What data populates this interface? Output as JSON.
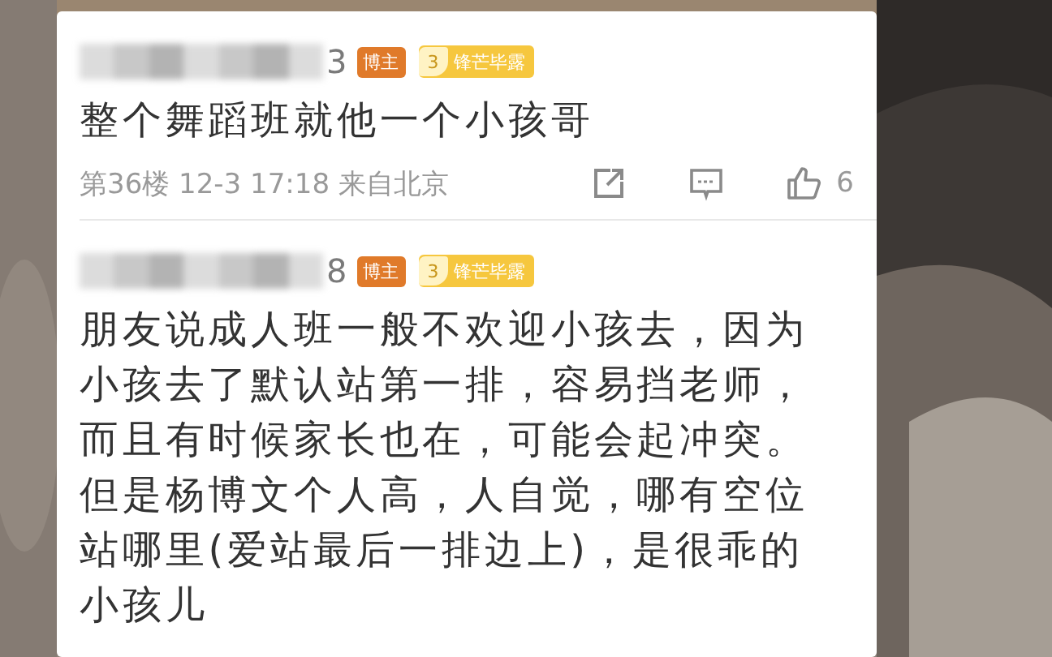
{
  "comments": [
    {
      "name_end": "3",
      "badges": [
        {
          "kind": "role",
          "label": "博主"
        },
        {
          "kind": "level",
          "number": "3",
          "label": "锋芒毕露"
        }
      ],
      "text": "整个舞蹈班就他一个小孩哥",
      "meta": "第36楼 12-3 17:18 来自北京",
      "like_count": "6"
    },
    {
      "name_end": "8",
      "badges": [
        {
          "kind": "role",
          "label": "博主"
        },
        {
          "kind": "level",
          "number": "3",
          "label": "锋芒毕露"
        }
      ],
      "text": "朋友说成人班一般不欢迎小孩去，因为小孩去了默认站第一排，容易挡老师，而且有时候家长也在，可能会起冲突。但是杨博文个人高，人自觉，哪有空位站哪里(爱站最后一排边上)，是很乖的小孩儿"
    }
  ]
}
